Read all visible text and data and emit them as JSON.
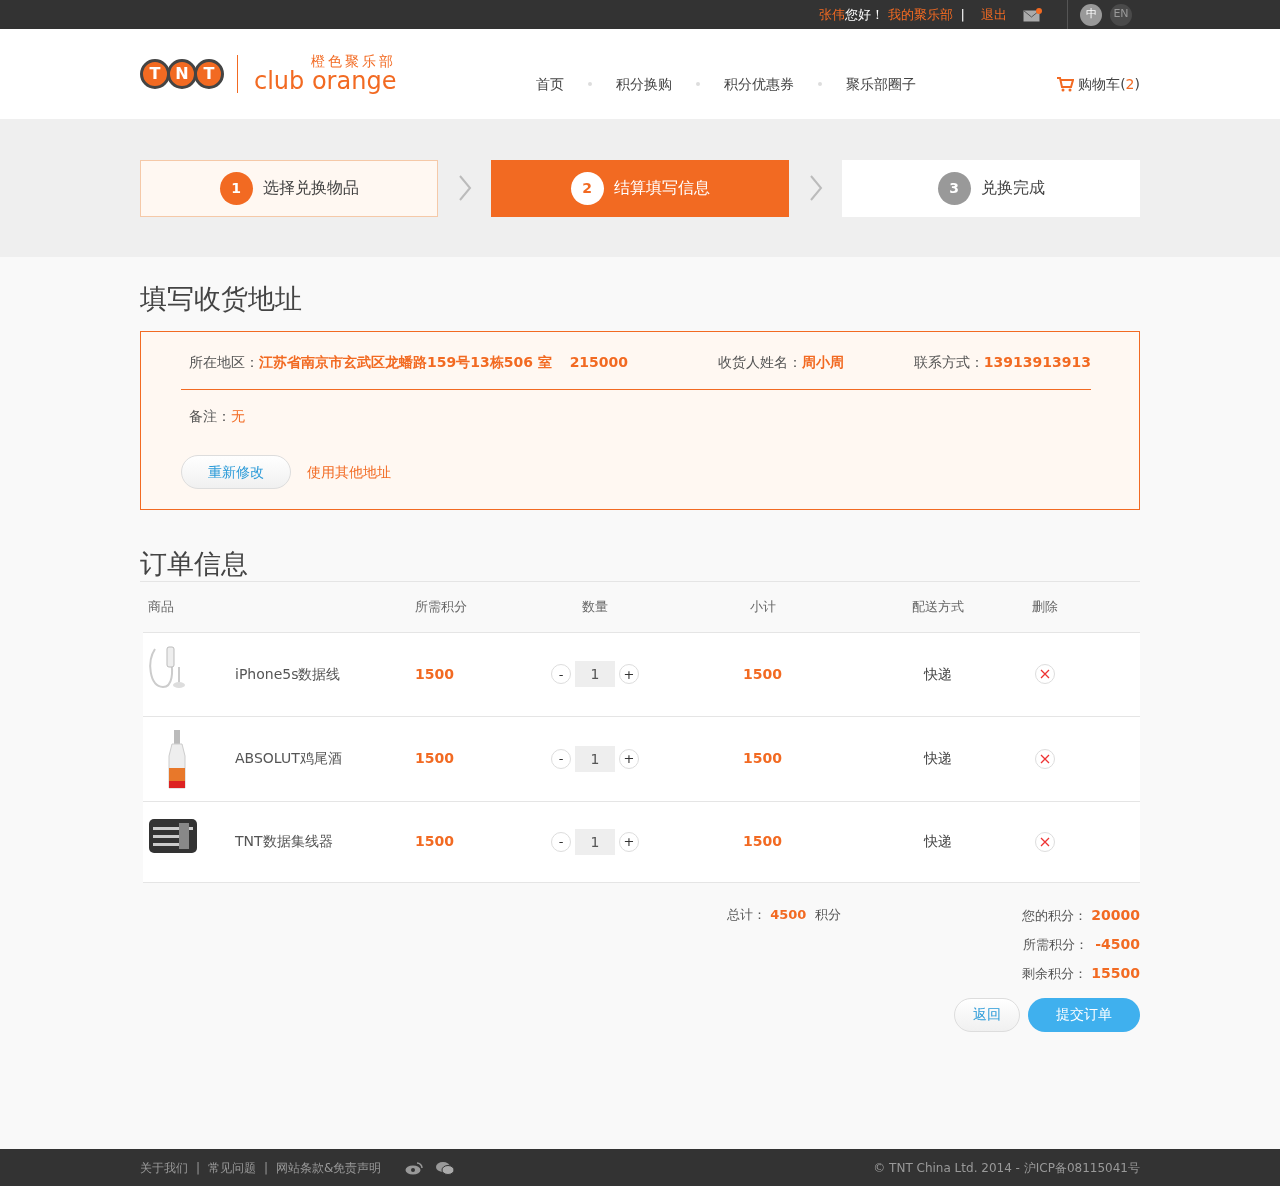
{
  "top_bar": {
    "user_name": "张伟",
    "greeting": "您好！",
    "my_club_link": "我的聚乐部",
    "separator": "|",
    "logout_link": "退出",
    "mail_unread": true,
    "languages": [
      {
        "label": "中",
        "selected": true
      },
      {
        "label": "EN",
        "selected": false
      }
    ]
  },
  "header": {
    "logo_letters": [
      "T",
      "N",
      "T"
    ],
    "logo_cn": "橙色聚乐部",
    "logo_en": "club orange",
    "nav": [
      {
        "label": "首页"
      },
      {
        "label": "积分换购"
      },
      {
        "label": "积分优惠券"
      },
      {
        "label": "聚乐部圈子"
      }
    ],
    "cart": {
      "label": "购物车(",
      "count": "2",
      "close": ")"
    }
  },
  "steps": [
    {
      "number": "1",
      "label": "选择兑换物品",
      "kind": "done"
    },
    {
      "number": "2",
      "label": "结算填写信息",
      "kind": "current"
    },
    {
      "number": "3",
      "label": "兑换完成",
      "kind": "todo"
    }
  ],
  "address": {
    "title": "填写收货地址",
    "region_label": "所在地区：",
    "region_value": "江苏省南京市玄武区龙蟠路159号13栋506 室",
    "postcode": "215000",
    "name_label": "收货人姓名：",
    "name_value": "周小周",
    "phone_label": "联系方式：",
    "phone_value": "13913913913",
    "note_label": "备注：",
    "note_value": "无",
    "edit_button": "重新修改",
    "other_address_link": "使用其他地址"
  },
  "order": {
    "title": "订单信息",
    "columns": [
      "商品",
      "所需积分",
      "数量",
      "小计",
      "配送方式",
      "删除"
    ],
    "rows": [
      {
        "kind": "cable",
        "name": "iPhone5s数据线",
        "points": "1500",
        "quantity": "1",
        "minus": "-",
        "plus": "+",
        "subtotal": "1500",
        "delivery": "快递"
      },
      {
        "kind": "bottle",
        "name": "ABSOLUT鸡尾酒",
        "points": "1500",
        "quantity": "1",
        "minus": "-",
        "plus": "+",
        "subtotal": "1500",
        "delivery": "快递"
      },
      {
        "kind": "organizer",
        "name": "TNT数据集线器",
        "points": "1500",
        "quantity": "1",
        "minus": "-",
        "plus": "+",
        "subtotal": "1500",
        "delivery": "快递"
      }
    ],
    "total_label": "总计：",
    "total_value": "4500",
    "total_unit": "积分",
    "summary": [
      {
        "label": "您的积分：",
        "value": "20000"
      },
      {
        "label": "所需积分：",
        "value": "-4500"
      },
      {
        "label": "剩余积分：",
        "value": "15500"
      }
    ],
    "back_button": "返回",
    "submit_button": "提交订单"
  },
  "footer": {
    "links": [
      "关于我们",
      "常见问题",
      "网站条款&免责声明"
    ],
    "separator": "|",
    "copyright": "© TNT China Ltd. 2014 - 沪ICP备08115041号"
  }
}
